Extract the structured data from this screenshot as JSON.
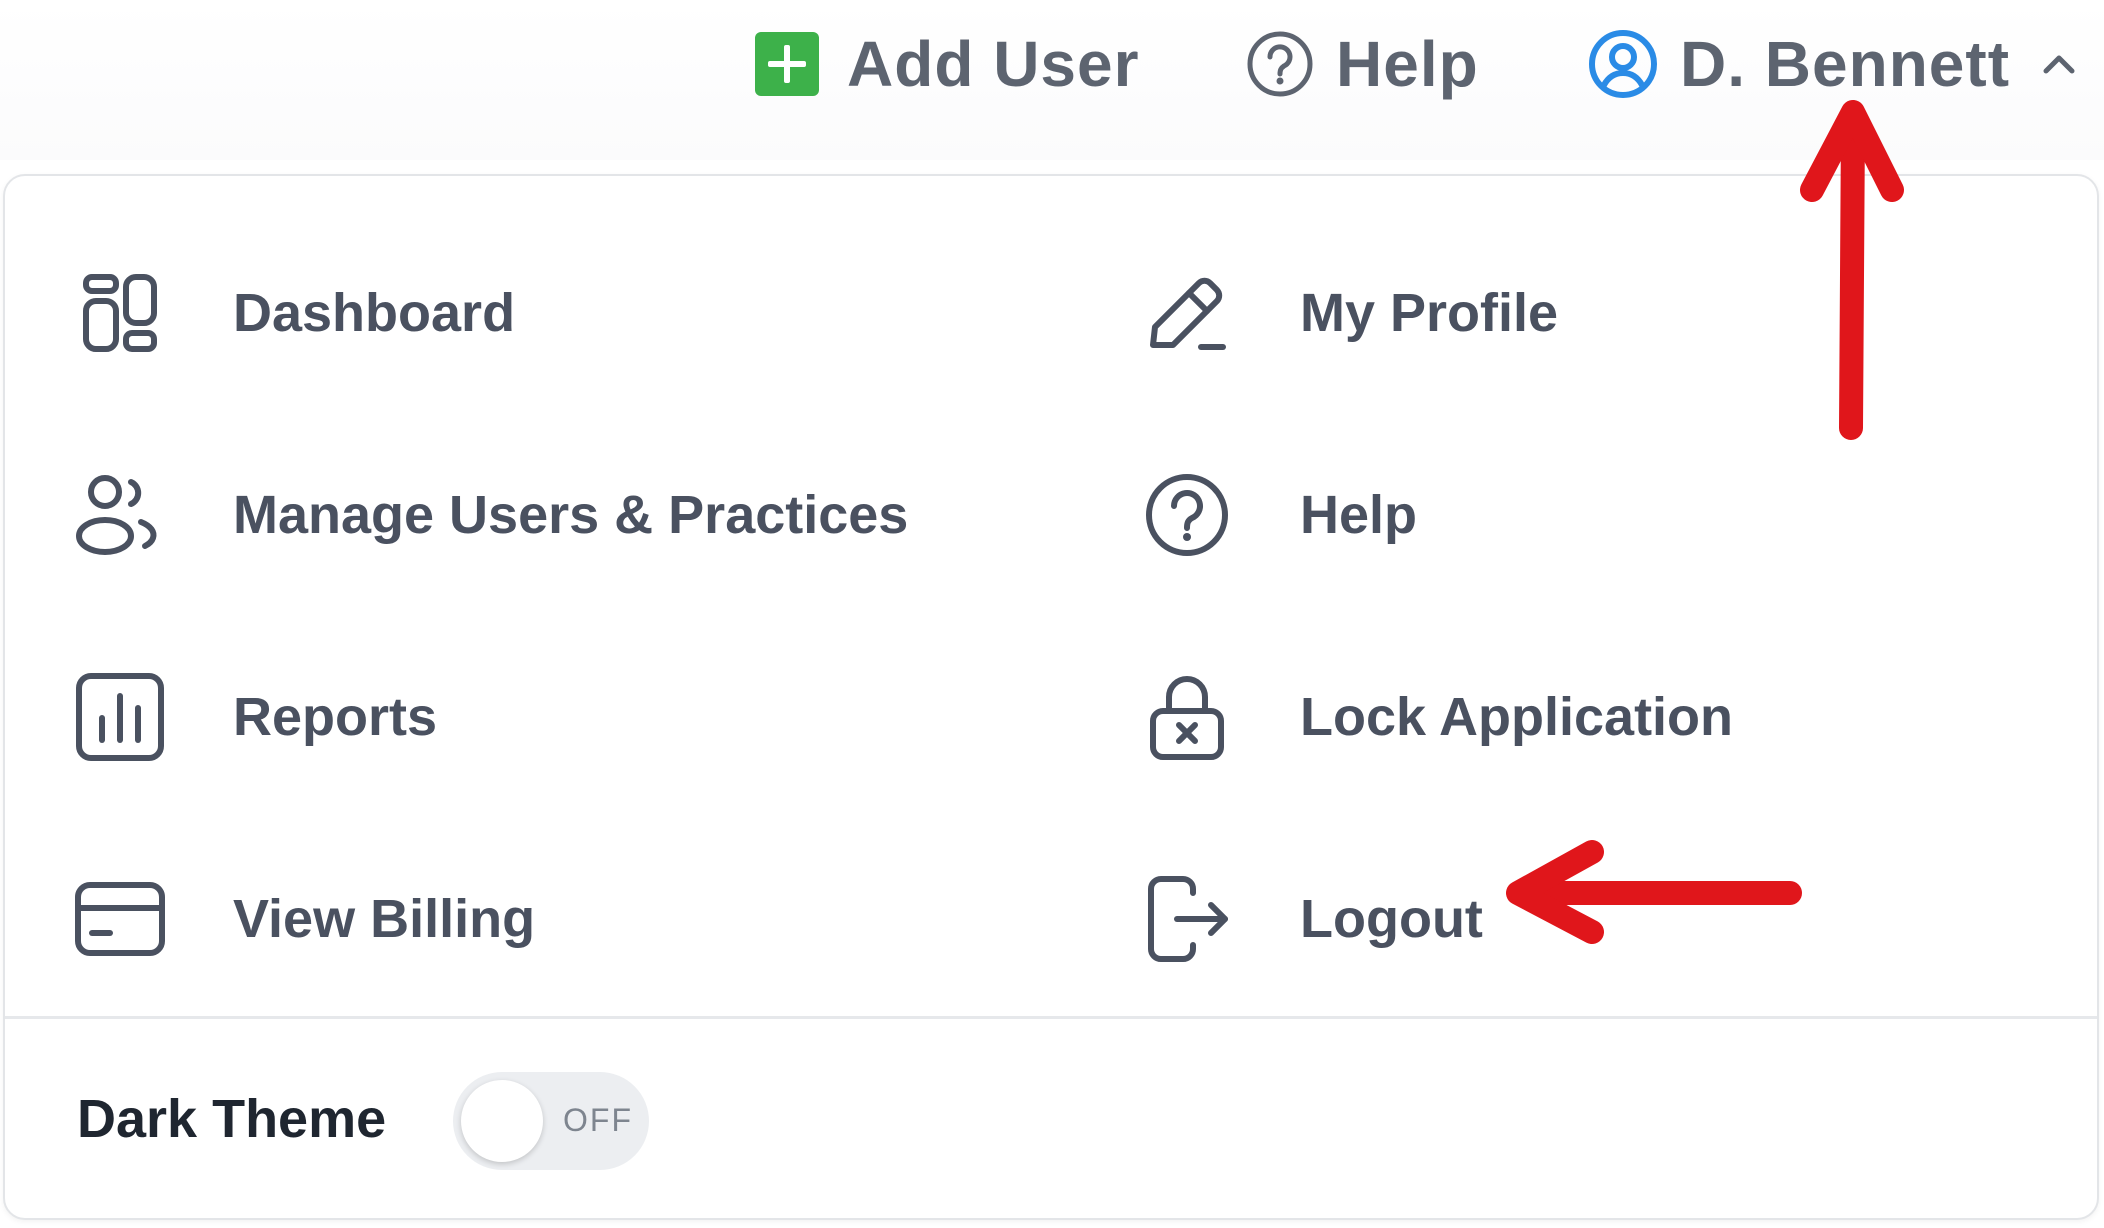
{
  "header": {
    "add_user_label": "Add User",
    "help_label": "Help",
    "user_name": "D. Bennett",
    "accent_green": "#3db14a",
    "accent_blue": "#2a8be6"
  },
  "menu": {
    "left": [
      {
        "label": "Dashboard",
        "icon": "dashboard-icon"
      },
      {
        "label": "Manage Users & Practices",
        "icon": "users-icon"
      },
      {
        "label": "Reports",
        "icon": "bar-chart-icon"
      },
      {
        "label": "View Billing",
        "icon": "credit-card-icon"
      }
    ],
    "right": [
      {
        "label": "My Profile",
        "icon": "pencil-icon"
      },
      {
        "label": "Help",
        "icon": "help-circle-icon"
      },
      {
        "label": "Lock Application",
        "icon": "lock-icon"
      },
      {
        "label": "Logout",
        "icon": "logout-icon"
      }
    ]
  },
  "dark_theme": {
    "label": "Dark Theme",
    "state_label": "OFF",
    "enabled": false
  },
  "annotations": {
    "arrow_color": "#e0161b",
    "arrows": [
      "up-arrow-to-user-menu",
      "left-arrow-to-logout"
    ]
  }
}
